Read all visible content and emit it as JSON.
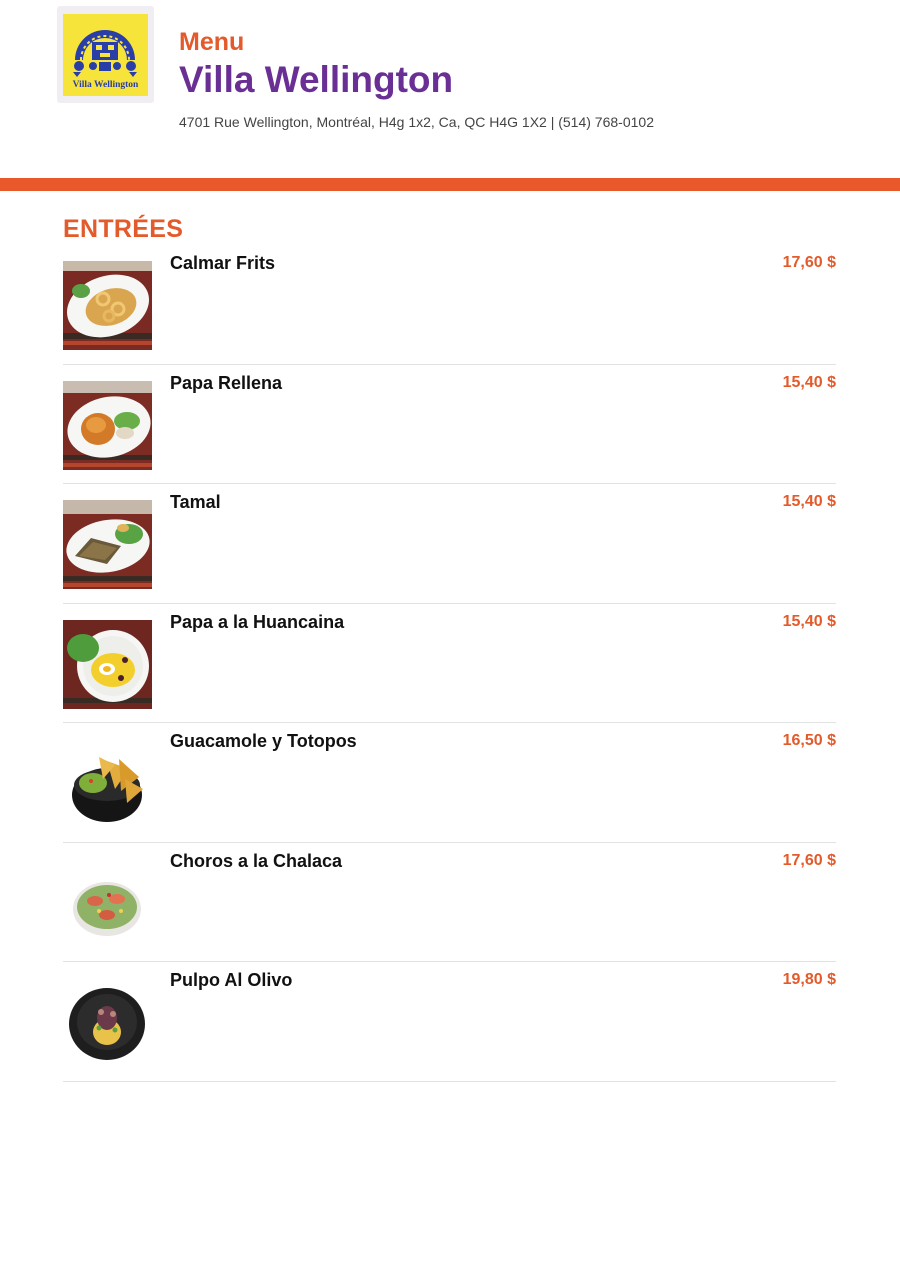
{
  "header": {
    "logo_text": "Villa Wellington",
    "menu_label": "Menu",
    "restaurant_name": "Villa Wellington",
    "address": "4701 Rue Wellington, Montréal, H4g 1x2, Ca, QC H4G 1X2 | (514) 768-0102"
  },
  "colors": {
    "accent": "#e35a2b",
    "brand_purple": "#6a2f94",
    "bar": "#e8582a",
    "logo_yellow": "#f7e43a",
    "logo_blue": "#2a3ea8"
  },
  "section": {
    "title": "ENTRÉES",
    "items": [
      {
        "name": "Calmar Frits",
        "price": "17,60 $",
        "image": "fried-calamari-photo"
      },
      {
        "name": "Papa Rellena",
        "price": "15,40 $",
        "image": "stuffed-potato-photo"
      },
      {
        "name": "Tamal",
        "price": "15,40 $",
        "image": "tamal-photo"
      },
      {
        "name": "Papa a la Huancaina",
        "price": "15,40 $",
        "image": "huancaina-potato-photo"
      },
      {
        "name": "Guacamole y Totopos",
        "price": "16,50 $",
        "image": "guacamole-chips-photo"
      },
      {
        "name": "Choros a la Chalaca",
        "price": "17,60 $",
        "image": "mussels-photo"
      },
      {
        "name": "Pulpo Al Olivo",
        "price": "19,80 $",
        "image": "octopus-olive-photo"
      }
    ]
  }
}
